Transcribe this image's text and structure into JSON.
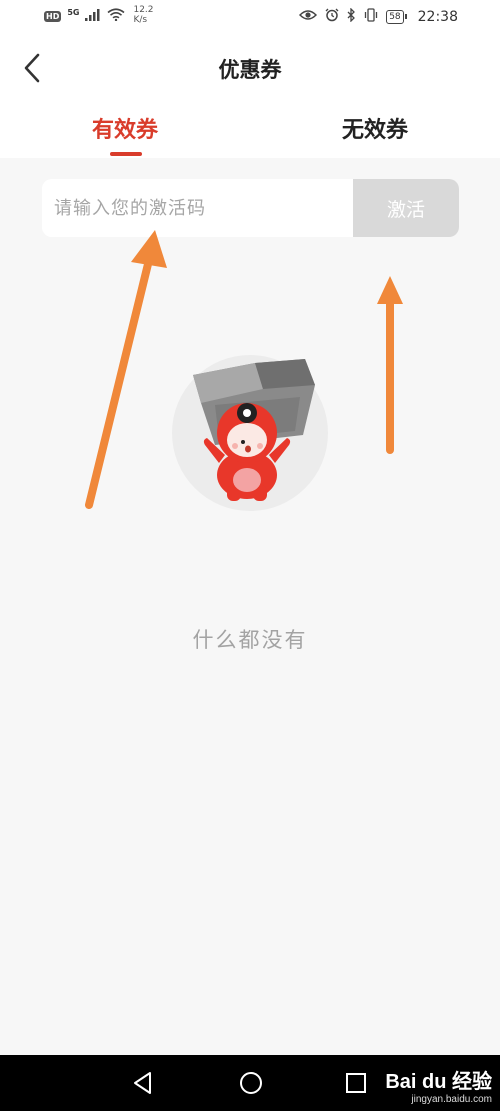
{
  "status_bar": {
    "hd": "HD",
    "signal": "5G",
    "net_speed_value": "12.2",
    "net_speed_unit": "K/s",
    "battery": "58",
    "time": "22:38"
  },
  "header": {
    "title": "优惠券"
  },
  "tabs": [
    {
      "label": "有效券",
      "active": true
    },
    {
      "label": "无效券",
      "active": false
    }
  ],
  "activation": {
    "placeholder": "请输入您的激活码",
    "value": "",
    "button_label": "激活"
  },
  "empty_state": {
    "message": "什么都没有"
  },
  "annotations": {
    "arrow_color": "#f0883a"
  },
  "watermark": {
    "logo": "Bai du 经验",
    "url": "jingyan.baidu.com"
  },
  "colors": {
    "accent": "#d93c2b",
    "page_bg": "#f7f7f7",
    "button_disabled": "#d9d9d9"
  }
}
